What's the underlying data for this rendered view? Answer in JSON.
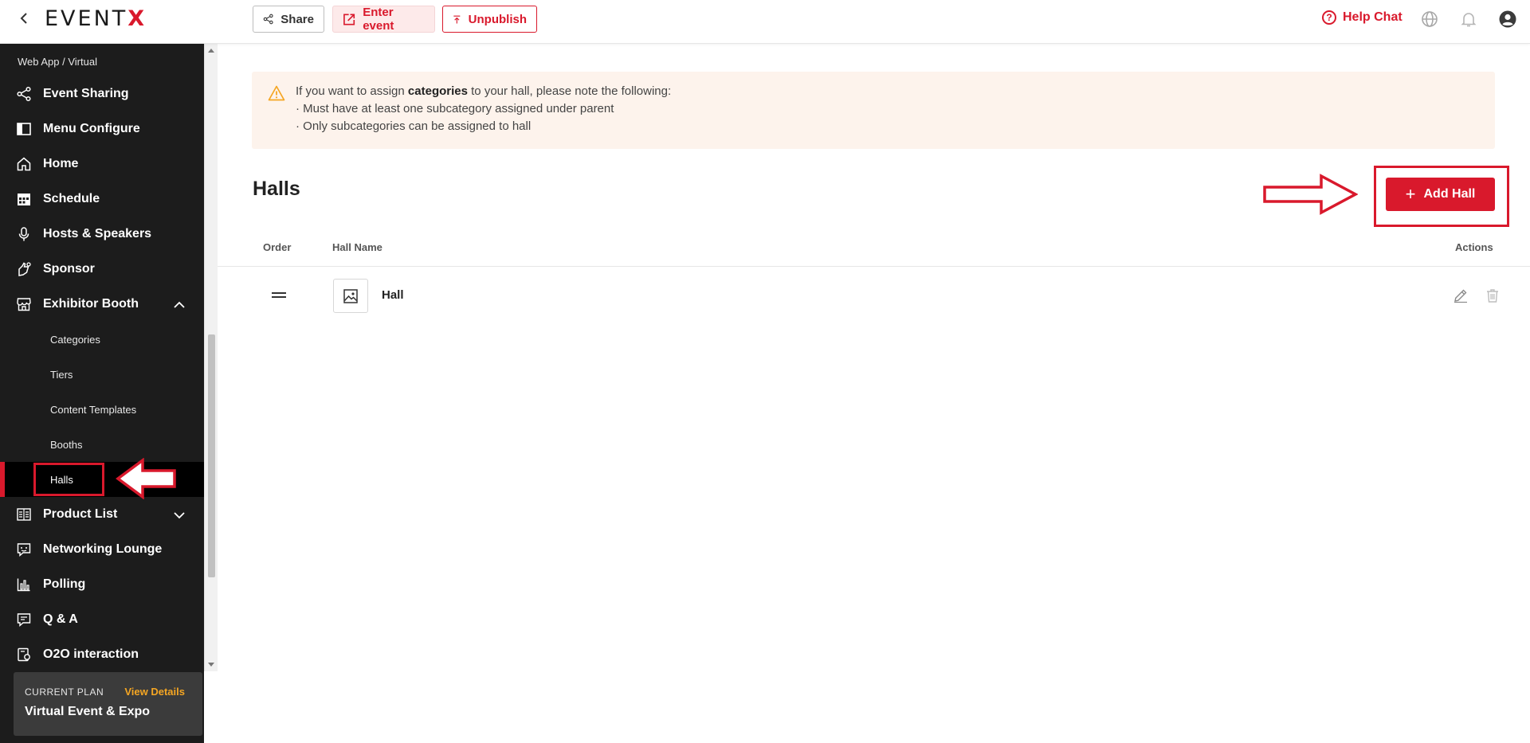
{
  "topbar": {
    "logo_main": "EVENT",
    "logo_accent": "X",
    "share_label": "Share",
    "enter_label": "Enter event",
    "unpublish_label": "Unpublish",
    "help_label": "Help Chat",
    "brand_color": "#d9192c"
  },
  "sidebar": {
    "breadcrumb": "Web App / Virtual",
    "items": [
      {
        "label": "Event Sharing",
        "icon": "share-icon"
      },
      {
        "label": "Menu Configure",
        "icon": "layout-icon"
      },
      {
        "label": "Home",
        "icon": "home-icon"
      },
      {
        "label": "Schedule",
        "icon": "calendar-icon"
      },
      {
        "label": "Hosts & Speakers",
        "icon": "microphone-icon"
      },
      {
        "label": "Sponsor",
        "icon": "sponsor-icon"
      },
      {
        "label": "Exhibitor Booth",
        "icon": "store-icon"
      },
      {
        "label": "Product List",
        "icon": "list-icon"
      },
      {
        "label": "Networking Lounge",
        "icon": "chat-icon"
      },
      {
        "label": "Polling",
        "icon": "bar-chart-icon"
      },
      {
        "label": "Q & A",
        "icon": "qa-icon"
      },
      {
        "label": "O2O interaction",
        "icon": "o2o-icon"
      }
    ],
    "sub_items": [
      "Categories",
      "Tiers",
      "Content Templates",
      "Booths",
      "Halls"
    ],
    "active_sub": "Halls",
    "plan": {
      "label": "CURRENT PLAN",
      "link": "View Details",
      "name": "Virtual Event & Expo"
    }
  },
  "notice": {
    "line1_pre": "If you want to assign ",
    "line1_bold": "categories",
    "line1_post": " to your hall, please note the following:",
    "line2": "· Must have at least one subcategory assigned under parent",
    "line3": "· Only subcategories can be assigned to hall"
  },
  "main": {
    "title": "Halls",
    "add_label": "Add Hall",
    "columns": {
      "order": "Order",
      "name": "Hall Name",
      "actions": "Actions"
    },
    "rows": [
      {
        "name": "Hall"
      }
    ]
  }
}
